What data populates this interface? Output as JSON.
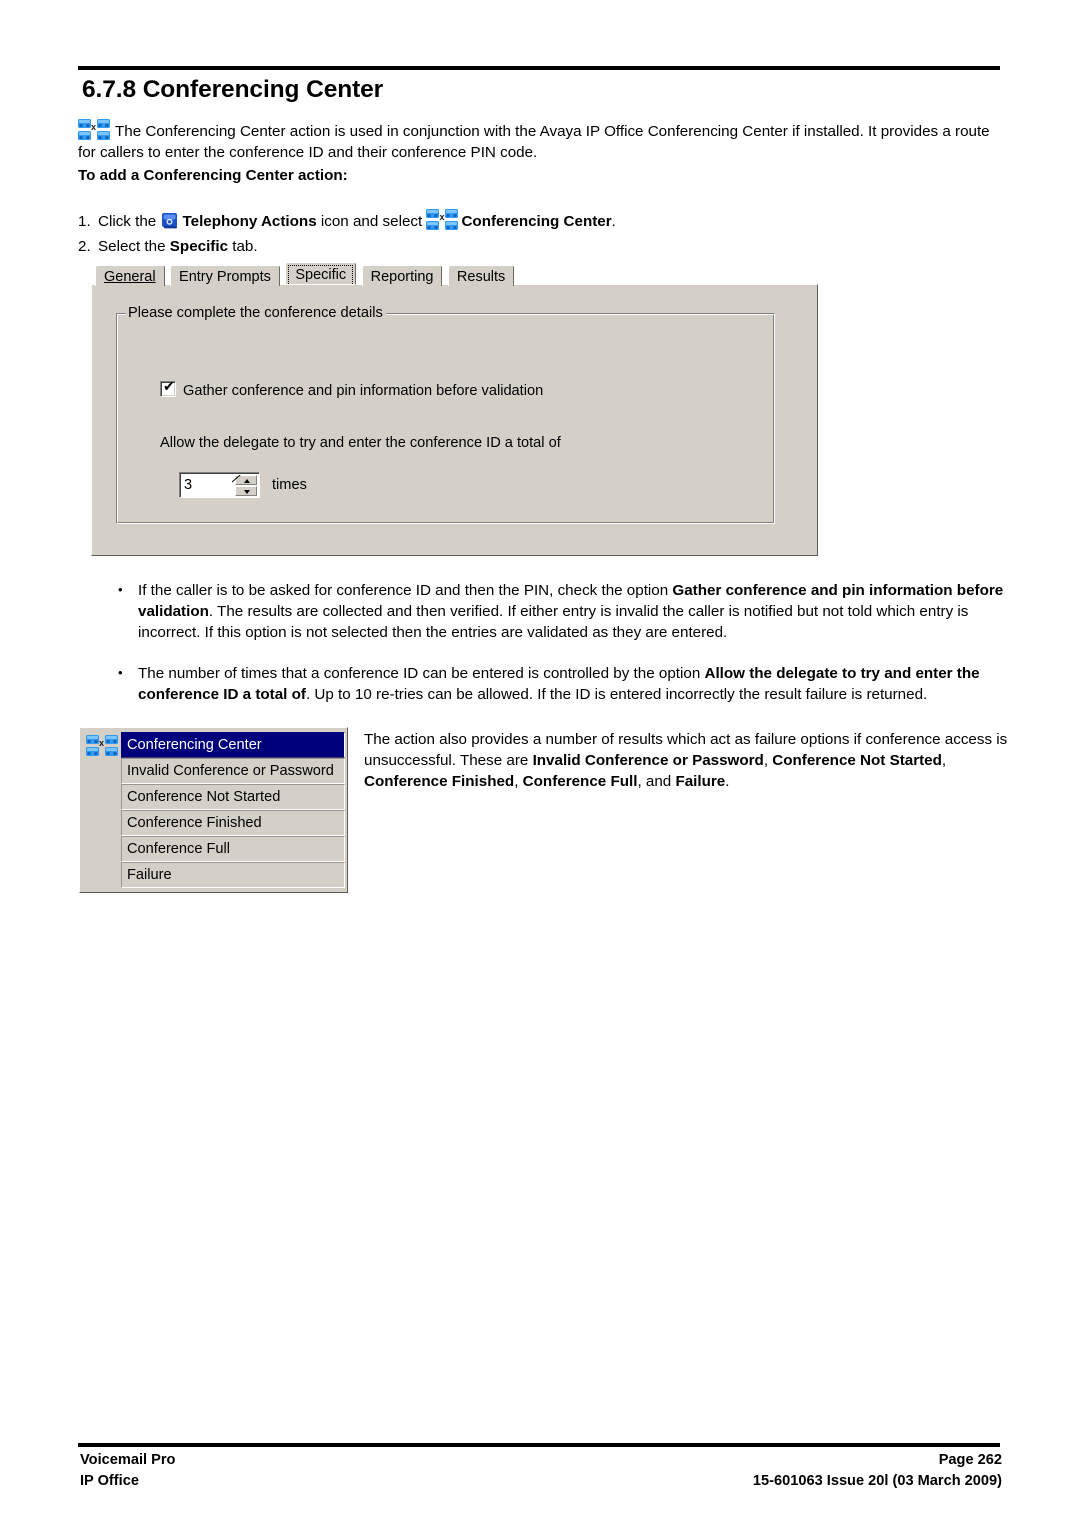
{
  "document": {
    "title": "6.7.8 Conferencing Center",
    "intro": "The Conferencing Center action is used in conjunction with the Avaya IP Office Conferencing Center if installed. It provides a route for callers to enter the conference ID and their conference PIN code.",
    "subheading": "To add a Conferencing Center action:",
    "icons": {
      "conferencing_center": "conferencing-center-phones-icon",
      "telephony_actions": "telephony-actions-phone-icon"
    },
    "steps": [
      {
        "number": "1.",
        "part1": "Click the",
        "bold1": "Telephony Actions",
        "part2": "icon and select",
        "bold2": "Conferencing Center",
        "part3": "."
      },
      {
        "number": "2.",
        "part1": "Select the",
        "bold1": "Specific",
        "part2": "tab."
      }
    ],
    "bullets": [
      {
        "seg1": "If the caller is to be asked for conference ID and then the PIN, check the option ",
        "bold1": "Gather conference and pin information before validation",
        "seg2": ". The results are collected and then verified. If either entry is invalid the caller is notified but not told which entry is incorrect. If this option is not selected then the entries are validated as they are entered."
      },
      {
        "seg1": "The number of times that a conference ID can be entered is controlled by the option ",
        "bold1": "Allow the delegate to try and enter the conference ID a total of",
        "seg2": ". Up to 10 re-tries can be allowed. If the ID is entered incorrectly the result failure is returned."
      }
    ],
    "results_paragraph": {
      "seg1": "The action also provides a number of results which act as failure options if conference access is unsuccessful. These are ",
      "bold1": "Invalid Conference or Password",
      "seg2": ", ",
      "bold2": "Conference Not Started",
      "seg3": ", ",
      "bold3": "Conference Finished",
      "seg4": ", ",
      "bold4": "Conference Full",
      "seg5": ", and ",
      "bold5": "Failure",
      "seg6": "."
    }
  },
  "dialog": {
    "tabs": [
      {
        "label": "General",
        "active": false,
        "accel": "G"
      },
      {
        "label": "Entry Prompts",
        "active": false,
        "accel": ""
      },
      {
        "label": "Specific",
        "active": true,
        "accel": ""
      },
      {
        "label": "Reporting",
        "active": false,
        "accel": "g"
      },
      {
        "label": "Results",
        "active": false,
        "accel": ""
      }
    ],
    "tab_labels": {
      "general": "General",
      "entry_prompts": "Entry Prompts",
      "specific": "Specific",
      "reporting": "Reporting",
      "results": "Results"
    },
    "groupbox_legend": "Please complete the conference details",
    "checkbox": {
      "label": "Gather conference and pin information before validation",
      "checked": true,
      "tick": "✔"
    },
    "allow_label": "Allow the delegate to try and enter the conference ID a total of",
    "spinner": {
      "value": "3",
      "unit_label": "times"
    }
  },
  "results_list": {
    "items": [
      {
        "label": "Conferencing Center",
        "selected": true
      },
      {
        "label": "Invalid Conference or Password",
        "selected": false
      },
      {
        "label": "Conference Not Started",
        "selected": false
      },
      {
        "label": "Conference Finished",
        "selected": false
      },
      {
        "label": "Conference Full",
        "selected": false
      },
      {
        "label": "Failure",
        "selected": false
      }
    ]
  },
  "footer": {
    "left_line1": "Voicemail Pro",
    "left_line2": "IP Office",
    "right_line1": "Page 262",
    "right_line2": "15-601063 Issue 20l (03 March 2009)"
  },
  "colors": {
    "dialog_face": "#d4d0c8",
    "selection": "#00007d",
    "icon_blue": "#2196f3",
    "rule": "#000000"
  }
}
